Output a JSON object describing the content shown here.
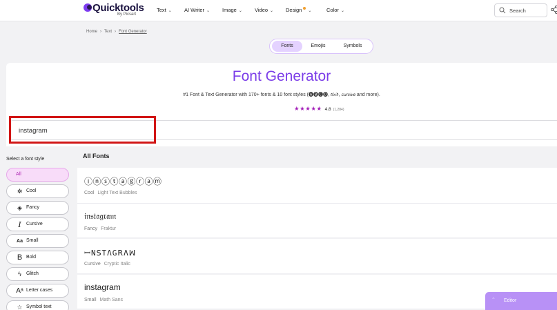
{
  "header": {
    "logo_name": "Quicktools",
    "logo_by": "By Picsart",
    "nav": [
      {
        "label": "Text"
      },
      {
        "label": "AI Writer"
      },
      {
        "label": "Image"
      },
      {
        "label": "Video"
      },
      {
        "label": "Design"
      },
      {
        "label": "Color"
      }
    ],
    "search_placeholder": "Search"
  },
  "breadcrumb": [
    "Home",
    "Text",
    "Font Generator"
  ],
  "tabs": [
    "Fonts",
    "Emojis",
    "Symbols"
  ],
  "hero": {
    "title": "Font Generator",
    "subtitle": "#1 Font & Text Generator with 170+ fonts & 10 font styles (🅐🅑🅒🅓, 𝔞𝔟𝔠𝔡, 𝘤𝘶𝘳𝘴𝘪𝘷𝘦 and more).",
    "stars": "★★★★★",
    "rating": "4.8",
    "rating_count": "(1,284)",
    "input_value": "instagram"
  },
  "sidebar": {
    "title": "Select a font style",
    "styles": [
      {
        "label": "All",
        "icon": "none"
      },
      {
        "label": "Cool",
        "icon": "sparkle-icon"
      },
      {
        "label": "Fancy",
        "icon": "diamond-icon"
      },
      {
        "label": "Cursive",
        "icon": "cursive-i-icon"
      },
      {
        "label": "Small",
        "icon": "aa-icon"
      },
      {
        "label": "Bold",
        "icon": "bold-b-icon"
      },
      {
        "label": "Glitch",
        "icon": "lightning-icon"
      },
      {
        "label": "Letter cases",
        "icon": "letter-case-icon"
      },
      {
        "label": "Symbol text",
        "icon": "star-icon"
      }
    ]
  },
  "results": {
    "title": "All Fonts",
    "rows": [
      {
        "text": "ⓘⓝⓢⓣⓐⓖⓡⓐⓜ",
        "category": "Cool",
        "font": "Light Text Bubbles"
      },
      {
        "text": "𝔦𝔫𝔰𝔱𝔞𝔤𝔯𝔞𝔪",
        "category": "Fancy",
        "font": "Fraktur"
      },
      {
        "text": "ꟷNꓢTΛGꓣΛꟽ",
        "category": "Cursive",
        "font": "Cryptic Italic"
      },
      {
        "text": "instagram",
        "category": "Small",
        "font": "Math Sans"
      }
    ]
  },
  "editor": {
    "label": "Editor"
  },
  "colors": {
    "brand_purple": "#7b3de8",
    "highlight_red": "#d11515",
    "star_magenta": "#a31fb8"
  }
}
